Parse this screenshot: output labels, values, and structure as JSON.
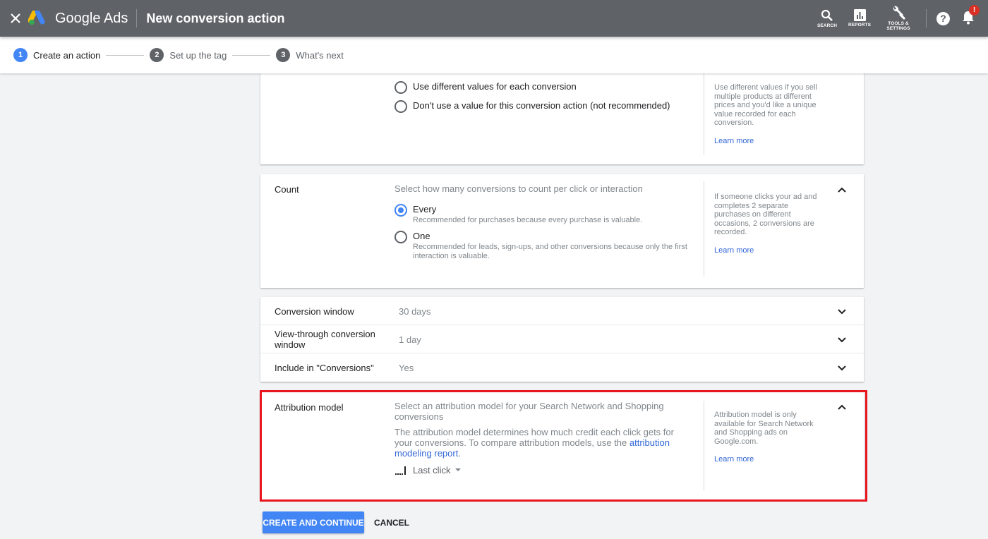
{
  "header": {
    "close_icon": "close-icon",
    "product_name": "Google Ads",
    "page_title": "New conversion action",
    "tools": [
      {
        "icon": "search-icon",
        "label": "SEARCH"
      },
      {
        "icon": "reports-icon",
        "label": "REPORTS"
      },
      {
        "icon": "wrench-icon",
        "label_line1": "TOOLS &",
        "label_line2": "SETTINGS"
      }
    ],
    "help_icon": "?",
    "notification_badge": "!"
  },
  "stepper": {
    "steps": [
      {
        "num": "1",
        "label": "Create an action",
        "active": true
      },
      {
        "num": "2",
        "label": "Set up the tag",
        "active": false
      },
      {
        "num": "3",
        "label": "What's next",
        "active": false
      }
    ]
  },
  "value_section": {
    "options": [
      {
        "label": "Use different values for each conversion",
        "selected": false
      },
      {
        "label": "Don't use a value for this conversion action (not recommended)",
        "selected": false
      }
    ],
    "help_text": "Use different values if you sell multiple products at different prices and you'd like a unique value recorded for each conversion.",
    "learn_more": "Learn more"
  },
  "count_section": {
    "label": "Count",
    "prompt": "Select how many conversions to count per click or interaction",
    "options": [
      {
        "label": "Every",
        "description": "Recommended for purchases because every purchase is valuable.",
        "selected": true
      },
      {
        "label": "One",
        "description": "Recommended for leads, sign-ups, and other conversions because only the first interaction is valuable.",
        "selected": false
      }
    ],
    "help_text": "If someone clicks your ad and completes 2 separate purchases on different occasions, 2 conversions are recorded.",
    "learn_more": "Learn more"
  },
  "settings_rows": [
    {
      "label": "Conversion window",
      "value": "30 days"
    },
    {
      "label": "View-through conversion window",
      "value": "1 day"
    },
    {
      "label": "Include in \"Conversions\"",
      "value": "Yes"
    }
  ],
  "attribution_section": {
    "label": "Attribution model",
    "prompt": "Select an attribution model for your Search Network and Shopping conversions",
    "description": "The attribution model determines how much credit each click gets for your conversions. To compare attribution models, use the",
    "link_text": "attribution modeling report",
    "link_suffix": ".",
    "selected_model": "Last click",
    "help_text": "Attribution model is only available for Search Network and Shopping ads on Google.com.",
    "learn_more": "Learn more",
    "highlight_color": "#e8141e"
  },
  "actions": {
    "primary": "CREATE AND CONTINUE",
    "cancel": "CANCEL"
  },
  "colors": {
    "header_bg": "#5f6368",
    "accent": "#4285f4",
    "link": "#3367d6"
  }
}
